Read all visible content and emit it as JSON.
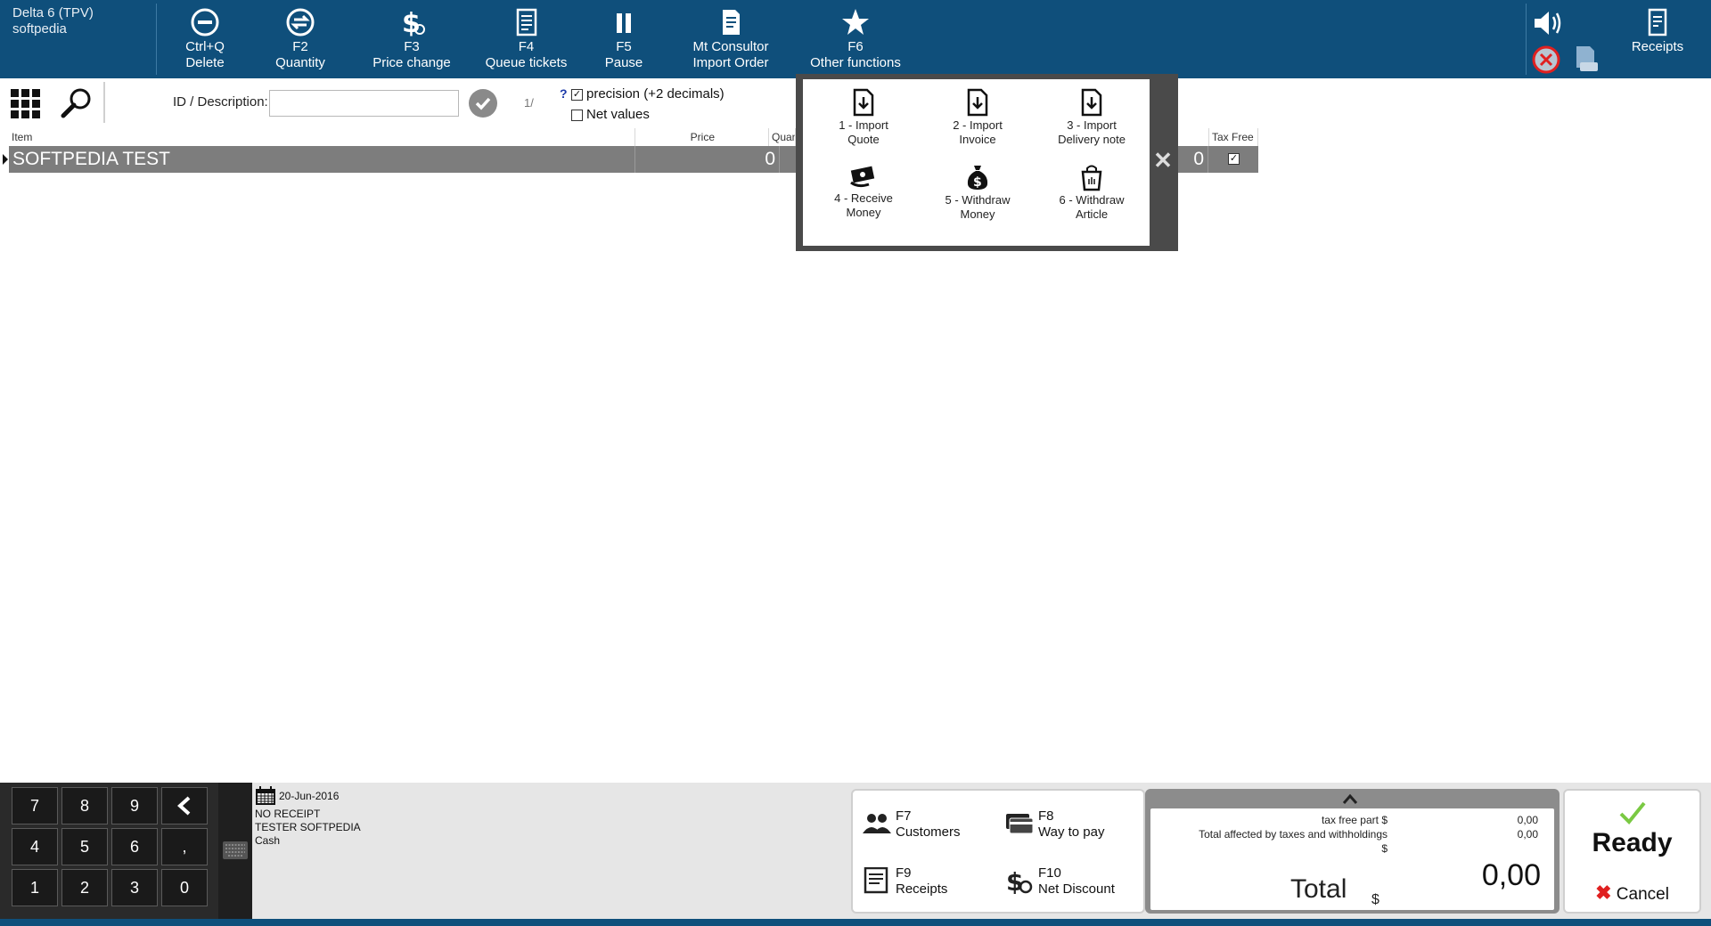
{
  "app": {
    "title": "Delta 6 (TPV)",
    "user": "softpedia"
  },
  "toolbar": {
    "delete": {
      "key": "Ctrl+Q",
      "label": "Delete"
    },
    "quantity": {
      "key": "F2",
      "label": "Quantity"
    },
    "price_change": {
      "key": "F3",
      "label": "Price change"
    },
    "queue_tickets": {
      "key": "F4",
      "label": "Queue tickets"
    },
    "pause": {
      "key": "F5",
      "label": "Pause"
    },
    "import_order": {
      "key": "Mt Consultor",
      "label": "Import Order"
    },
    "other_functions": {
      "key": "F6",
      "label": "Other functions"
    },
    "receipts": {
      "label": "Receipts"
    }
  },
  "search": {
    "id_label": "ID / Description:",
    "value": "",
    "page_indicator": "1/"
  },
  "options": {
    "help": "?",
    "precision": {
      "label": "precision (+2 decimals)",
      "checked": true
    },
    "net_values": {
      "label": "Net values",
      "checked": false
    }
  },
  "table": {
    "headers": {
      "item": "Item",
      "price": "Price",
      "quantity": "Quan",
      "tax_free": "Tax Free"
    },
    "rows": [
      {
        "item": "SOFTPEDIA TEST",
        "price": "0",
        "total": "0",
        "tax_free": true
      }
    ]
  },
  "popup": {
    "items": [
      {
        "label_1": "1 - Import",
        "label_2": "Quote"
      },
      {
        "label_1": "2 - Import",
        "label_2": "Invoice"
      },
      {
        "label_1": "3 - Import",
        "label_2": "Delivery note"
      },
      {
        "label_1": "4 - Receive",
        "label_2": "Money"
      },
      {
        "label_1": "5 - Withdraw",
        "label_2": "Money"
      },
      {
        "label_1": "6 - Withdraw",
        "label_2": "Article"
      }
    ]
  },
  "keypad": {
    "keys": [
      "7",
      "8",
      "9",
      "4",
      "5",
      "6",
      ",",
      "1",
      "2",
      "3",
      "0"
    ]
  },
  "receipt": {
    "date": "20-Jun-2016",
    "receipt_status": "NO RECEIPT",
    "user": "TESTER SOFTPEDIA",
    "payment": "Cash"
  },
  "functions": {
    "customers": {
      "key": "F7",
      "label": "Customers"
    },
    "way_to_pay": {
      "key": "F8",
      "label": "Way to pay"
    },
    "receipts": {
      "key": "F9",
      "label": "Receipts"
    },
    "net_discount": {
      "key": "F10",
      "label": "Net Discount"
    }
  },
  "totals": {
    "tax_free_label": "tax free part $",
    "tax_free_value": "0,00",
    "affected_label": "Total affected by taxes and withholdings",
    "affected_unit": "$",
    "affected_value": "0,00",
    "total_label": "Total",
    "total_unit": "$",
    "total_value": "0,00"
  },
  "actions": {
    "ready": "Ready",
    "cancel": "Cancel"
  },
  "colors": {
    "topbar": "#0f4f7b",
    "row": "#7d7d7d",
    "popup_frame": "#4a4a4a",
    "keypad": "#2a2a2a",
    "ready_check": "#7ac943",
    "cancel_x": "#e02020"
  }
}
